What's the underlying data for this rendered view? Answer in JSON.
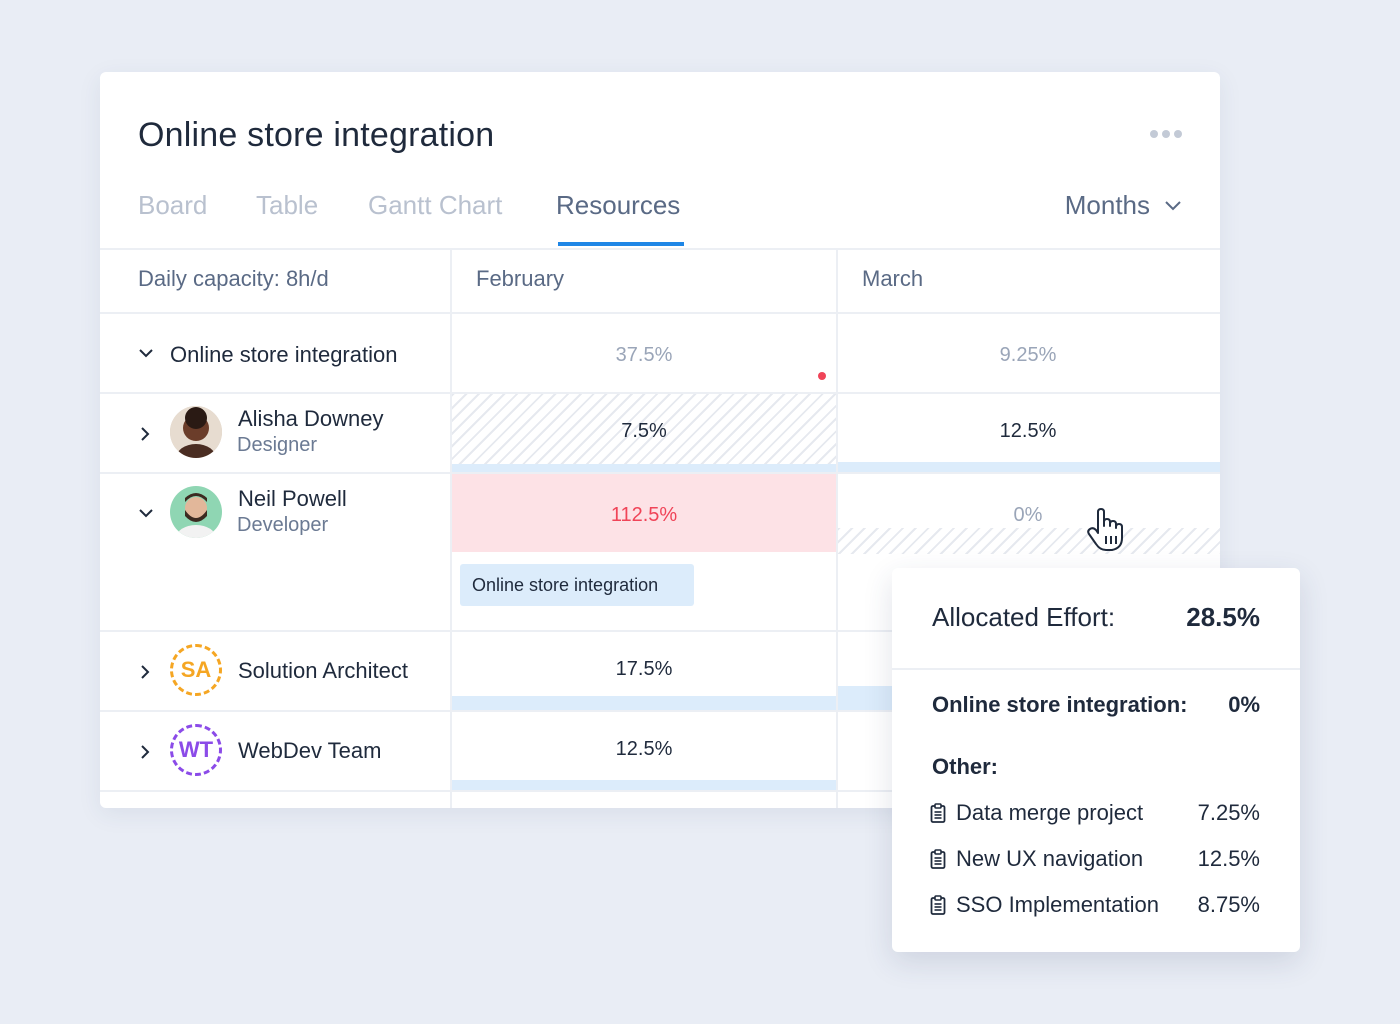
{
  "header": {
    "title": "Online store integration",
    "tabs": [
      {
        "label": "Board",
        "active": false
      },
      {
        "label": "Table",
        "active": false
      },
      {
        "label": "Gantt Chart",
        "active": false
      },
      {
        "label": "Resources",
        "active": true
      }
    ],
    "period_select": "Months"
  },
  "grid": {
    "capacity_label": "Daily capacity: 8h/d",
    "columns": [
      "February",
      "March"
    ],
    "rows": [
      {
        "label": "Online store integration",
        "expanded": true,
        "feb": "37.5%",
        "mar": "9.25%"
      },
      {
        "label": "Alisha Downey",
        "sub": "Designer",
        "expanded": false,
        "feb": "7.5%",
        "mar": "12.5%"
      },
      {
        "label": "Neil Powell",
        "sub": "Developer",
        "expanded": true,
        "feb": "112.5%",
        "mar": "0%",
        "task": "Online store integration"
      },
      {
        "label": "Solution Architect",
        "initials": "SA",
        "expanded": false,
        "feb": "17.5%"
      },
      {
        "label": "WebDev Team",
        "initials": "WT",
        "expanded": false,
        "feb": "12.5%"
      }
    ]
  },
  "popup": {
    "allocated_label": "Allocated Effort:",
    "allocated_value": "28.5%",
    "project_label": "Online store integration:",
    "project_value": "0%",
    "other_label": "Other:",
    "other_items": [
      {
        "name": "Data merge project",
        "value": "7.25%",
        "icon": "clipboard-icon"
      },
      {
        "name": "New UX navigation",
        "value": "12.5%",
        "icon": "clipboard-icon"
      },
      {
        "name": "SSO Implementation",
        "value": "8.75%",
        "icon": "clipboard-icon"
      }
    ]
  },
  "colors": {
    "accent": "#1e86e6",
    "over_capacity_bg": "#fde2e6",
    "over_capacity_text": "#f04458",
    "sa_color": "#f5a623",
    "wt_color": "#8b4be8",
    "bar": "#dcecfb"
  }
}
